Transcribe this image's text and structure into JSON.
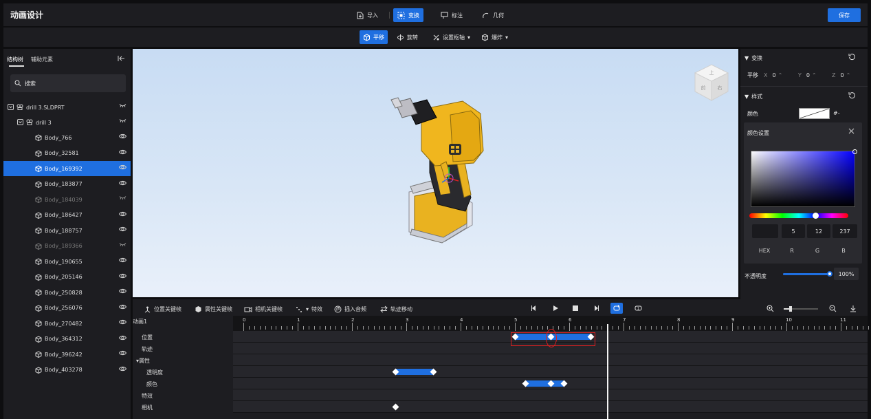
{
  "app": {
    "title": "动画设计",
    "save_label": "保存"
  },
  "toolbar": {
    "import": "导入",
    "transform": "变换",
    "annotate": "标注",
    "geometry": "几何"
  },
  "subbar": {
    "translate": "平移",
    "rotate": "旋转",
    "set_axis": "设置枢轴",
    "explode": "爆炸"
  },
  "left": {
    "tabs": [
      "结构树",
      "辅助元素"
    ],
    "search_placeholder": "搜索",
    "root": "drill 3.SLDPRT",
    "assembly": "drill 3",
    "bodies": [
      {
        "name": "Body_766",
        "visible": true
      },
      {
        "name": "Body_32581",
        "visible": true
      },
      {
        "name": "Body_169392",
        "visible": true,
        "selected": true
      },
      {
        "name": "Body_183877",
        "visible": true
      },
      {
        "name": "Body_184039",
        "visible": false
      },
      {
        "name": "Body_186427",
        "visible": true
      },
      {
        "name": "Body_188757",
        "visible": true
      },
      {
        "name": "Body_189366",
        "visible": false
      },
      {
        "name": "Body_190655",
        "visible": true
      },
      {
        "name": "Body_205146",
        "visible": true
      },
      {
        "name": "Body_250828",
        "visible": true
      },
      {
        "name": "Body_256076",
        "visible": true
      },
      {
        "name": "Body_270482",
        "visible": true
      },
      {
        "name": "Body_364312",
        "visible": true
      },
      {
        "name": "Body_396242",
        "visible": true
      },
      {
        "name": "Body_403278",
        "visible": true
      }
    ]
  },
  "viewcube": {
    "top": "上",
    "front": "前",
    "right": "右"
  },
  "right": {
    "transform_title": "变换",
    "translate_label": "平移",
    "x_label": "X",
    "x_value": "0",
    "y_label": "Y",
    "y_value": "0",
    "z_label": "Z",
    "z_value": "0",
    "style_title": "样式",
    "color_label": "颜色",
    "color_hex_text": "#-",
    "picker": {
      "title": "颜色设置",
      "values": {
        "hex": "",
        "r": "5",
        "g": "12",
        "b": "237"
      },
      "labels": {
        "hex": "HEX",
        "r": "R",
        "g": "G",
        "b": "B"
      },
      "hue": 0.67
    },
    "opacity_label": "不透明度",
    "opacity_value": "100%",
    "opacity": 1.0
  },
  "timeline": {
    "tools": {
      "pos_key": "位置关键帧",
      "attr_key": "属性关键帧",
      "cam_key": "相机关键帧",
      "effects": "特效",
      "audio": "插入音频",
      "track_move": "轨迹移动"
    },
    "animation_name": "动画1",
    "tracks": [
      "位置",
      "轨迹",
      "▾属性",
      "透明度",
      "颜色",
      "特效",
      "相机"
    ],
    "ticks": [
      "0",
      "1",
      "2",
      "3",
      "4",
      "5",
      "6",
      "7",
      "8",
      "9",
      "10",
      "11"
    ],
    "playhead": 6.7,
    "zoom": 0.2,
    "segments": [
      {
        "track": 0,
        "start": 5.0,
        "end": 6.4,
        "keys": [
          5.0,
          5.67,
          6.4
        ]
      },
      {
        "track": 3,
        "start": 2.8,
        "end": 3.5,
        "keys": [
          2.8,
          3.5
        ]
      },
      {
        "track": 4,
        "start": 5.2,
        "end": 5.9,
        "keys": [
          5.2,
          5.67,
          5.9
        ]
      },
      {
        "track": 6,
        "keys": [
          2.8
        ]
      }
    ],
    "colors": {
      "accent": "#1f6fe0",
      "highlight": "#e02020"
    }
  }
}
